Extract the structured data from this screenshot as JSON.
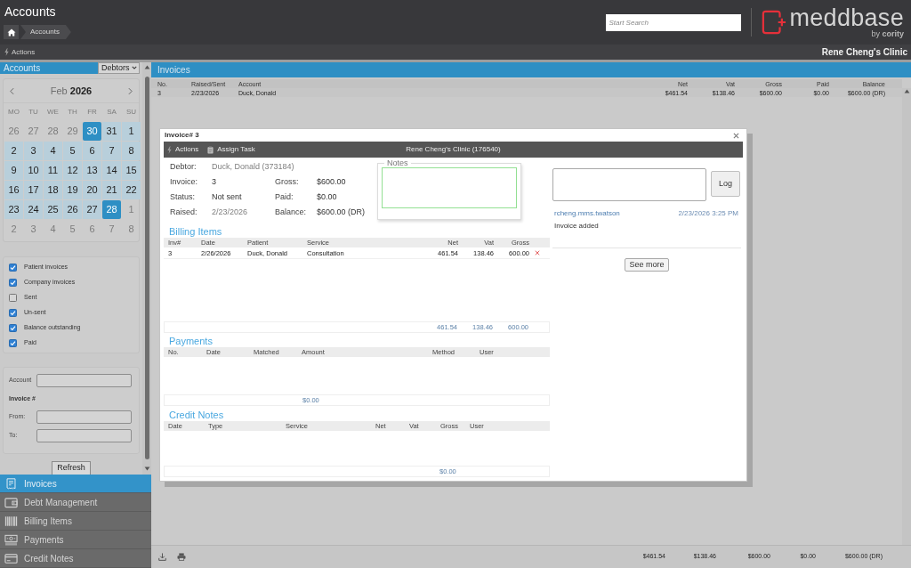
{
  "header": {
    "title": "Accounts",
    "breadcrumb": [
      {
        "label": "Accounts"
      }
    ],
    "search": {
      "placeholder": "Start Search"
    },
    "logo": {
      "wordmark": "meddbase",
      "tagline": "by **cority**"
    }
  },
  "action_bar": {
    "actions": "Actions",
    "clinic": "Rene Cheng's Clinic"
  },
  "sidebar": {
    "title": "Accounts",
    "view_select": "Debtors",
    "calendar": {
      "month": "Feb",
      "year": "2026",
      "weekdays": [
        "MO",
        "TU",
        "WE",
        "TH",
        "FR",
        "SA",
        "SU"
      ],
      "weeks": [
        [
          {
            "day": "26",
            "in_range": false,
            "selected": false
          },
          {
            "day": "27",
            "in_range": false,
            "selected": false
          },
          {
            "day": "28",
            "in_range": false,
            "selected": false
          },
          {
            "day": "29",
            "in_range": false,
            "selected": false
          },
          {
            "day": "30",
            "in_range": true,
            "selected": true
          },
          {
            "day": "31",
            "in_range": true,
            "selected": false
          },
          {
            "day": "1",
            "in_range": true,
            "selected": false
          }
        ],
        [
          {
            "day": "2",
            "in_range": true,
            "selected": false
          },
          {
            "day": "3",
            "in_range": true,
            "selected": false
          },
          {
            "day": "4",
            "in_range": true,
            "selected": false
          },
          {
            "day": "5",
            "in_range": true,
            "selected": false
          },
          {
            "day": "6",
            "in_range": true,
            "selected": false
          },
          {
            "day": "7",
            "in_range": true,
            "selected": false
          },
          {
            "day": "8",
            "in_range": true,
            "selected": false
          }
        ],
        [
          {
            "day": "9",
            "in_range": true,
            "selected": false
          },
          {
            "day": "10",
            "in_range": true,
            "selected": false
          },
          {
            "day": "11",
            "in_range": true,
            "selected": false
          },
          {
            "day": "12",
            "in_range": true,
            "selected": false
          },
          {
            "day": "13",
            "in_range": true,
            "selected": false
          },
          {
            "day": "14",
            "in_range": true,
            "selected": false
          },
          {
            "day": "15",
            "in_range": true,
            "selected": false
          }
        ],
        [
          {
            "day": "16",
            "in_range": true,
            "selected": false
          },
          {
            "day": "17",
            "in_range": true,
            "selected": false
          },
          {
            "day": "18",
            "in_range": true,
            "selected": false
          },
          {
            "day": "19",
            "in_range": true,
            "selected": false
          },
          {
            "day": "20",
            "in_range": true,
            "selected": false
          },
          {
            "day": "21",
            "in_range": true,
            "selected": false
          },
          {
            "day": "22",
            "in_range": true,
            "selected": false
          }
        ],
        [
          {
            "day": "23",
            "in_range": true,
            "selected": false
          },
          {
            "day": "24",
            "in_range": true,
            "selected": false
          },
          {
            "day": "25",
            "in_range": true,
            "selected": false
          },
          {
            "day": "26",
            "in_range": true,
            "selected": false
          },
          {
            "day": "27",
            "in_range": true,
            "selected": false
          },
          {
            "day": "28",
            "in_range": true,
            "selected": true
          },
          {
            "day": "1",
            "in_range": false,
            "selected": false
          }
        ],
        [
          {
            "day": "2",
            "in_range": false,
            "selected": false
          },
          {
            "day": "3",
            "in_range": false,
            "selected": false
          },
          {
            "day": "4",
            "in_range": false,
            "selected": false
          },
          {
            "day": "5",
            "in_range": false,
            "selected": false
          },
          {
            "day": "6",
            "in_range": false,
            "selected": false
          },
          {
            "day": "7",
            "in_range": false,
            "selected": false
          },
          {
            "day": "8",
            "in_range": false,
            "selected": false
          }
        ]
      ]
    },
    "filters": [
      {
        "label": "Patient invoices",
        "checked": true
      },
      {
        "label": "Company invoices",
        "checked": true
      },
      {
        "label": "Sent",
        "checked": false
      },
      {
        "label": "Un-sent",
        "checked": true
      },
      {
        "label": "Balance outstanding",
        "checked": true
      },
      {
        "label": "Paid",
        "checked": true
      }
    ],
    "search_form": [
      {
        "kind": "field",
        "label": "Account"
      },
      {
        "kind": "heading",
        "label": "Invoice #"
      },
      {
        "kind": "field",
        "label": "From:"
      },
      {
        "kind": "field",
        "label": "To:"
      }
    ],
    "refresh_button": "Refresh",
    "nav": [
      {
        "label": "Invoices",
        "selected": true
      },
      {
        "label": "Debt Management",
        "selected": false
      },
      {
        "label": "Billing Items",
        "selected": false
      },
      {
        "label": "Payments",
        "selected": false
      },
      {
        "label": "Credit Notes",
        "selected": false
      }
    ]
  },
  "invoices": {
    "title": "Invoices",
    "columns": [
      "No.",
      "Raised/Sent",
      "Account",
      "Net",
      "Vat",
      "Gross",
      "Paid",
      "Balance"
    ],
    "rows": [
      [
        "3",
        "2/23/2026",
        "Duck, Donald",
        "$461.54",
        "$138.46",
        "$600.00",
        "$0.00",
        "$600.00 (DR)"
      ]
    ],
    "totals": [
      "$461.54",
      "$138.46",
      "$600.00",
      "$0.00",
      "$600.00 (DR)"
    ]
  },
  "dialog": {
    "title": "Invoice# 3",
    "toolbar": {
      "buttons": [
        {
          "label": "Actions"
        },
        {
          "label": "Assign Task"
        }
      ],
      "clinic": "Rene Cheng's Clinic (176540)"
    },
    "summary": [
      [
        {
          "label": "Debtor:",
          "value": "Duck, Donald (373184)",
          "muted": true
        }
      ],
      [
        {
          "label": "Invoice:",
          "value": "3",
          "muted": false
        },
        {
          "label": "Gross:",
          "value": "$600.00",
          "muted": false
        }
      ],
      [
        {
          "label": "Status:",
          "value": "Not sent",
          "muted": false
        },
        {
          "label": "Paid:",
          "value": "$0.00",
          "muted": false
        }
      ],
      [
        {
          "label": "Raised:",
          "value": "2/23/2026",
          "muted": true
        },
        {
          "label": "Balance:",
          "value": "$600.00 (DR)",
          "muted": false
        }
      ]
    ],
    "notes": {
      "legend": "Notes"
    },
    "sections": [
      {
        "kind": "billing",
        "title": "Billing Items",
        "columns": [
          {
            "label": "Inv#"
          },
          {
            "label": "Date"
          },
          {
            "label": "Patient"
          },
          {
            "label": "Service"
          },
          {
            "label": "Net",
            "total": "461.54"
          },
          {
            "label": "Vat",
            "total": "138.46"
          },
          {
            "label": "Gross",
            "total": "600.00"
          }
        ],
        "rows": [
          [
            "3",
            "2/26/2026",
            "Duck, Donald",
            "Consultation",
            "461.54",
            "138.46",
            "600.00"
          ]
        ]
      },
      {
        "kind": "payments",
        "title": "Payments",
        "columns": [
          {
            "label": "No."
          },
          {
            "label": "Date"
          },
          {
            "label": "Matched"
          },
          {
            "label": "Amount",
            "total": "$0.00"
          },
          {
            "label": "Method"
          },
          {
            "label": "User"
          }
        ]
      },
      {
        "kind": "credit_notes",
        "title": "Credit Notes",
        "columns": [
          {
            "label": "Date"
          },
          {
            "label": "Type"
          },
          {
            "label": "Service"
          },
          {
            "label": "Net"
          },
          {
            "label": "Vat"
          },
          {
            "label": "Gross",
            "total": "$0.00"
          },
          {
            "label": "User"
          }
        ]
      }
    ],
    "log": {
      "button": "Log",
      "entries": [
        {
          "user": "rcheng.mms.twatson",
          "time": "2/23/2026 3:25 PM",
          "text": "Invoice added"
        }
      ],
      "see_more": "See more"
    }
  }
}
